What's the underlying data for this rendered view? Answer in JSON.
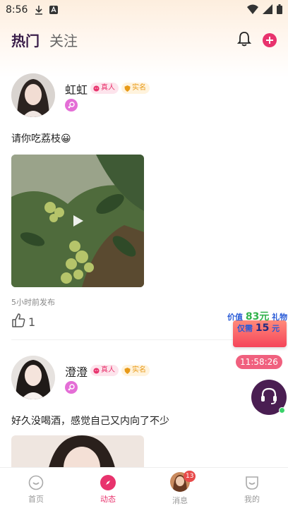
{
  "status_bar": {
    "time": "8:56"
  },
  "header": {
    "tabs": [
      {
        "label": "热门"
      },
      {
        "label": "关注"
      }
    ]
  },
  "badges": {
    "real_person": "真人",
    "verified": "实名"
  },
  "posts": [
    {
      "username": "虹虹",
      "text": "请你吃荔枝😀",
      "time": "5小时前发布",
      "likes": "1"
    },
    {
      "username": "澄澄",
      "text": "好久没喝酒，感觉自己又内向了不少"
    }
  ],
  "promo": {
    "line1_prefix": "价值",
    "line1_amount": "83元",
    "line1_suffix": "礼物",
    "line2_prefix": "仅需",
    "line2_amount": "15",
    "line2_suffix": "元"
  },
  "timer": "11:58:26",
  "bottom_nav": {
    "items": [
      {
        "label": "首页"
      },
      {
        "label": "动态"
      },
      {
        "label": "消息",
        "badge": "13"
      },
      {
        "label": "我的"
      }
    ]
  },
  "colors": {
    "accent": "#e8336d",
    "tab_active": "#3a1e4a",
    "headset_bg": "#4a1e52"
  }
}
